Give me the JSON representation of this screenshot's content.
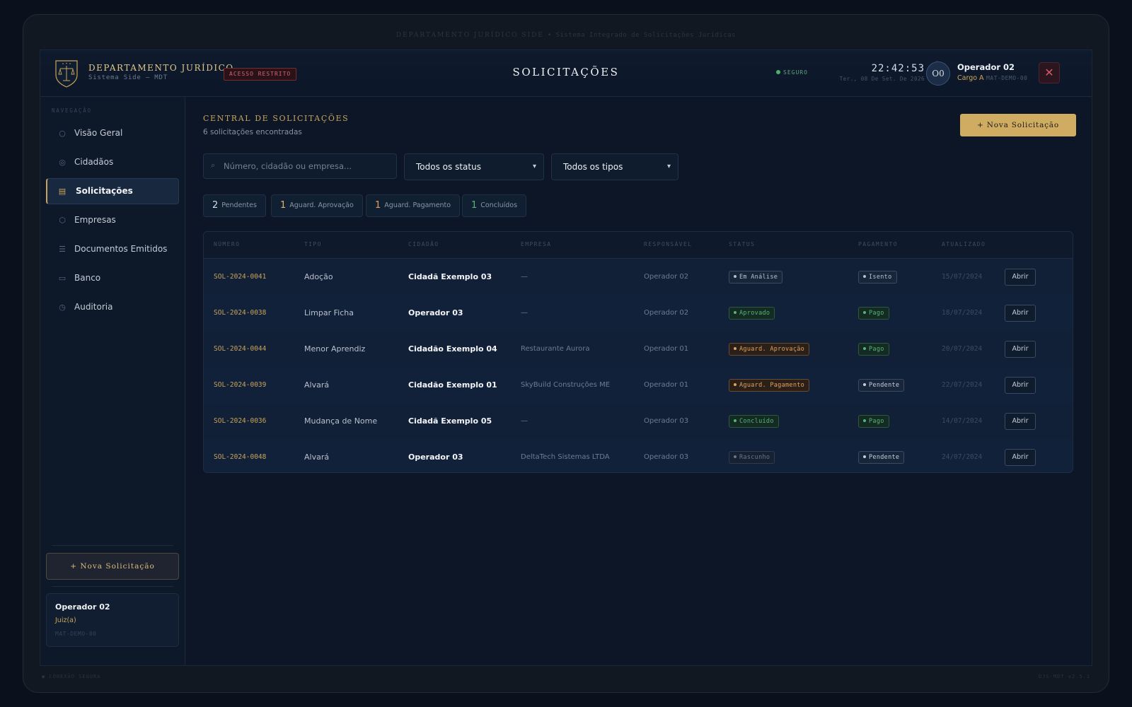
{
  "bezel": {
    "top_title": "DEPARTAMENTO JURÍDICO SIDE",
    "top_subtitle": "• Sistema Integrado de Solicitações Jurídicas",
    "foot_left": "● CONEXÃO SEGURA",
    "foot_right": "DJS-MDT v2.5.1"
  },
  "header": {
    "brand_title": "DEPARTAMENTO JURÍDICO",
    "brand_subtitle": "Sistema Side — MDT",
    "restricted_badge": "ACESSO RESTRITO",
    "page_title": "SOLICITAÇÕES",
    "secure_label": "SEGURO",
    "clock": "22:42:53",
    "date": "Ter., 08 De Set. De 2026",
    "avatar_initials": "O0",
    "user_name": "Operador 02",
    "user_role": "Cargo A",
    "user_mat": "MAT-DEMO-00",
    "close_symbol": "✕"
  },
  "sidebar": {
    "caption": "NAVEGAÇÃO",
    "items": [
      {
        "label": "Visão Geral",
        "icon": "circle-icon",
        "glyph": "○"
      },
      {
        "label": "Cidadãos",
        "icon": "person-icon",
        "glyph": "◎"
      },
      {
        "label": "Solicitações",
        "icon": "document-list-icon",
        "glyph": "▤"
      },
      {
        "label": "Empresas",
        "icon": "building-icon",
        "glyph": "⬡"
      },
      {
        "label": "Documentos Emitidos",
        "icon": "lines-icon",
        "glyph": "☰"
      },
      {
        "label": "Banco",
        "icon": "card-icon",
        "glyph": "▭"
      },
      {
        "label": "Auditoria",
        "icon": "clock-icon",
        "glyph": "◷"
      }
    ],
    "active_index": 2,
    "new_button": "+ Nova Solicitação",
    "user": {
      "name": "Operador 02",
      "role": "Juiz(a)",
      "mat": "MAT-DEMO-00"
    }
  },
  "main": {
    "title": "CENTRAL DE SOLICITAÇÕES",
    "count": "6 solicitações encontradas",
    "new_button": "+ Nova Solicitação",
    "search_placeholder": "Número, cidadão ou empresa...",
    "status_filter": "Todos os status",
    "type_filter": "Todos os tipos",
    "chips": [
      {
        "count": "2",
        "label": "Pendentes",
        "color": "#d6dce6"
      },
      {
        "count": "1",
        "label": "Aguard. Aprovação",
        "color": "#d9b470"
      },
      {
        "count": "1",
        "label": "Aguard. Pagamento",
        "color": "#e2a15b"
      },
      {
        "count": "1",
        "label": "Concluídos",
        "color": "#57b577"
      }
    ]
  },
  "table": {
    "headers": [
      "NÚMERO",
      "TIPO",
      "CIDADÃO",
      "EMPRESA",
      "RESPONSÁVEL",
      "STATUS",
      "PAGAMENTO",
      "ATUALIZADO"
    ],
    "open_label": "Abrir",
    "rows": [
      {
        "numero": "SOL-2024-0041",
        "tipo": "Adoção",
        "cidadao": "Cidadã Exemplo 03",
        "empresa": "—",
        "responsavel": "Operador 02",
        "status": "Em Análise",
        "status_class": "b-analise",
        "pagamento": "Isento",
        "pag_class": "b-isento",
        "atualizado": "15/07/2024"
      },
      {
        "numero": "SOL-2024-0038",
        "tipo": "Limpar Ficha",
        "cidadao": "Operador 03",
        "empresa": "—",
        "responsavel": "Operador 02",
        "status": "Aprovado",
        "status_class": "b-aprovado",
        "pagamento": "Pago",
        "pag_class": "b-pago",
        "atualizado": "18/07/2024"
      },
      {
        "numero": "SOL-2024-0044",
        "tipo": "Menor Aprendiz",
        "cidadao": "Cidadão Exemplo 04",
        "empresa": "Restaurante Aurora",
        "responsavel": "Operador 01",
        "status": "Aguard. Aprovação",
        "status_class": "b-aguard",
        "pagamento": "Pago",
        "pag_class": "b-pago",
        "atualizado": "20/07/2024"
      },
      {
        "numero": "SOL-2024-0039",
        "tipo": "Alvará",
        "cidadao": "Cidadão Exemplo 01",
        "empresa": "SkyBuild Construções ME",
        "responsavel": "Operador 01",
        "status": "Aguard. Pagamento",
        "status_class": "b-aguard",
        "pagamento": "Pendente",
        "pag_class": "b-pendente",
        "atualizado": "22/07/2024"
      },
      {
        "numero": "SOL-2024-0036",
        "tipo": "Mudança de Nome",
        "cidadao": "Cidadã Exemplo 05",
        "empresa": "—",
        "responsavel": "Operador 03",
        "status": "Concluído",
        "status_class": "b-concluido",
        "pagamento": "Pago",
        "pag_class": "b-pago",
        "atualizado": "14/07/2024"
      },
      {
        "numero": "SOL-2024-0048",
        "tipo": "Alvará",
        "cidadao": "Operador 03",
        "empresa": "DeltaTech Sistemas LTDA",
        "responsavel": "Operador 03",
        "status": "Rascunho",
        "status_class": "b-rascunho",
        "pagamento": "Pendente",
        "pag_class": "b-pendente",
        "atualizado": "24/07/2024"
      }
    ]
  }
}
